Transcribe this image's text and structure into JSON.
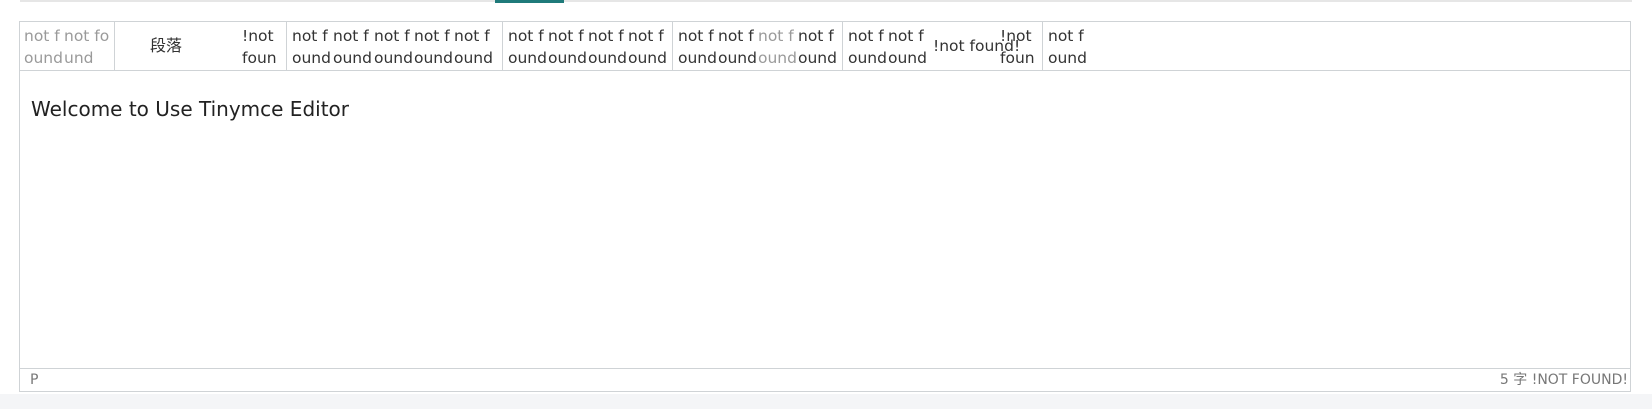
{
  "toolbar": {
    "group1": [
      "not found",
      "not found"
    ],
    "format_select": "段落",
    "group2": [
      "!not found"
    ],
    "group3": [
      "not found",
      "not found",
      "not found",
      "not found",
      "not found"
    ],
    "group4": [
      "not found",
      "not found",
      "not found",
      "not found"
    ],
    "group5": [
      "not found",
      "not found",
      "not found",
      "not found"
    ],
    "group6": [
      "not found",
      "not found"
    ],
    "inline_label": "!not found!",
    "group7": [
      "!not found",
      "not found"
    ]
  },
  "content": {
    "paragraph": "Welcome to Use Tinymce Editor"
  },
  "statusbar": {
    "path": "P",
    "word_count": "5 字",
    "branding": "!NOT FOUND!"
  },
  "colors": {
    "accent": "#1f7a7a",
    "border": "#cfd3d6",
    "disabled_text": "#9a9a9a"
  }
}
